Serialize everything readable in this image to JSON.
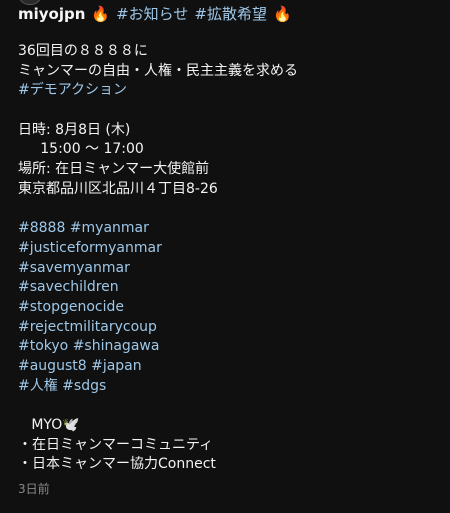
{
  "header": {
    "username": "miyojpn",
    "emoji_fire": "🔥",
    "tag1": "#お知らせ",
    "tag2": "#拡散希望"
  },
  "post": {
    "intro": [
      "36回目の８８８８に",
      "ミャンマーの自由・人権・民主主義を求める"
    ],
    "intro_tag": "#デモアクション",
    "date": "日時: 8月8日 (木)",
    "time": "     15:00 〜 17:00",
    "place": "場所: 在日ミャンマー大使館前",
    "address": "東京都品川区北品川４丁目8-26",
    "hashtags": [
      "#8888 #myanmar",
      "#justiceformyanmar",
      "#savemyanmar",
      "#savechildren",
      "#stopgenocide",
      "#rejectmilitarycoup",
      "#tokyo #shinagawa",
      "#august8 #japan",
      "#人権 #sdgs"
    ],
    "signature": "   MYO🕊️",
    "orgs": [
      "・在日ミャンマーコミュニティ",
      "・日本ミャンマー協力Connect"
    ]
  },
  "timestamp": "3日前"
}
